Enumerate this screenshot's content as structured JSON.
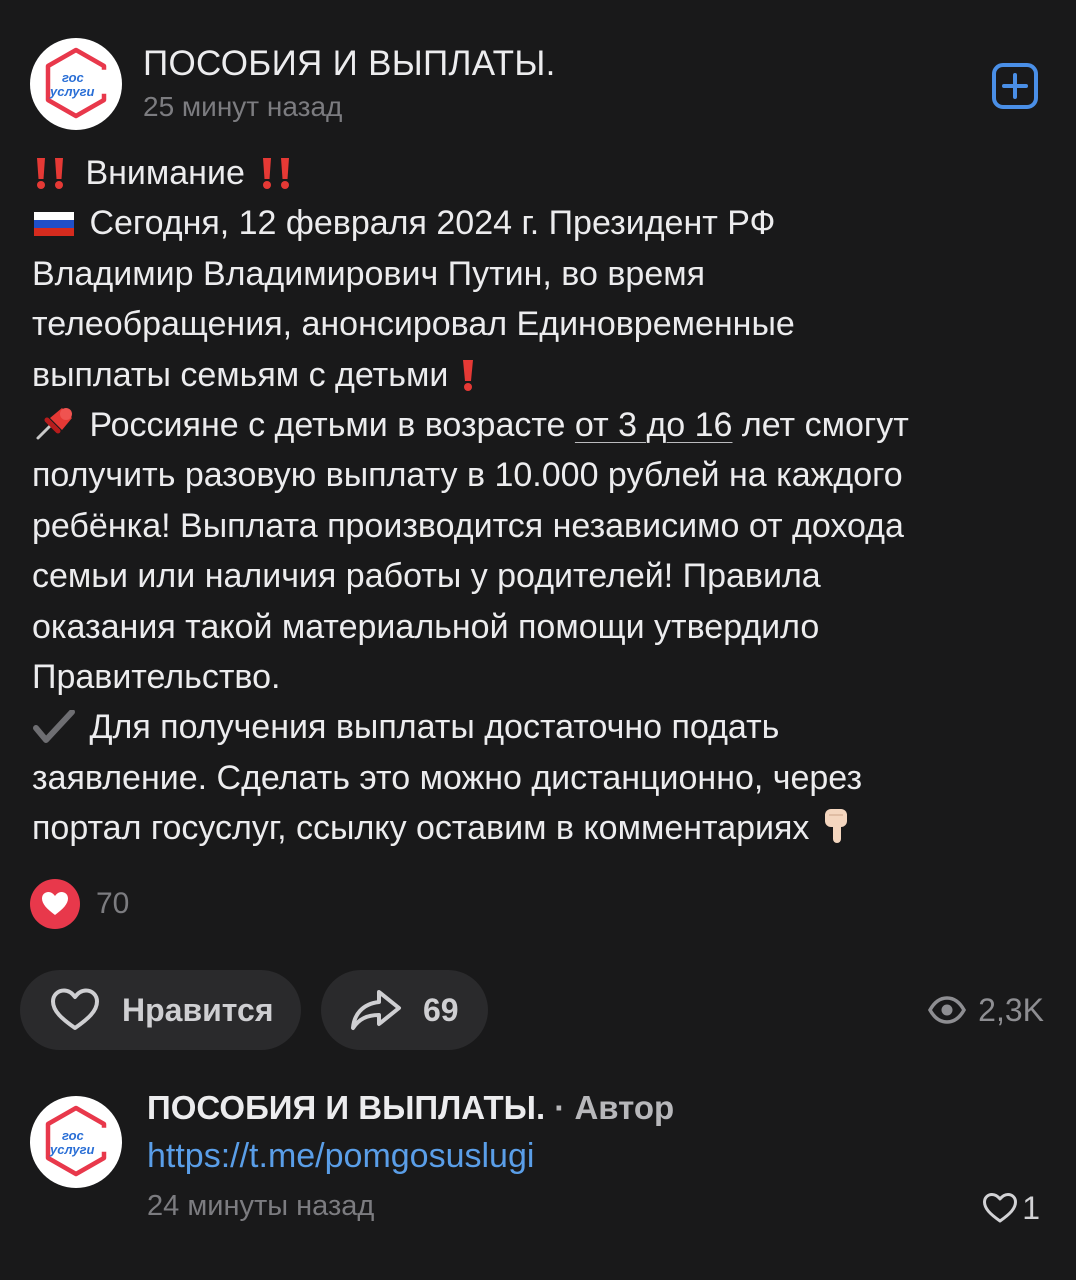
{
  "post": {
    "channel_name": "ПОСОБИЯ И ВЫПЛАТЫ.",
    "time": "25 минут назад",
    "avatar_text_top": "гос",
    "avatar_text_bottom": "услуги",
    "lines": {
      "l1_text": "Внимание",
      "l2_text": "Сегодня, 12 февраля 2024 г. Президент РФ",
      "l3_text": "Владимир Владимирович Путин, во время",
      "l4_text": "телеобращения, анонсировал Единовременные",
      "l5_text": "выплаты семьям с детьми",
      "l6_pre": "Россияне с детьми в возрасте ",
      "l6_underlined": "от 3 до 16",
      "l6_post": " лет смогут",
      "l7_text": "получить разовую выплату в 10.000 рублей на каждого",
      "l8_text": "ребёнка! Выплата производится независимо от дохода",
      "l9_text": "семьи или наличия работы у родителей! Правила",
      "l10_text": "оказания такой материальной помощи утвердило",
      "l11_text": "Правительство.",
      "l12_text": "Для получения выплаты достаточно подать",
      "l13_text": "заявление. Сделать это можно дистанционно, через",
      "l14_text": "портал госуслуг, ссылку оставим в комментариях"
    },
    "emoji": {
      "double_exclamation": "double-exclamation-icon",
      "russia_flag": "russia-flag-icon",
      "red_exclamation": "red-exclamation-icon",
      "pushpin": "pushpin-icon",
      "check_mark": "check-mark-icon",
      "point_down": "pointing-down-hand-icon"
    },
    "reaction_count": "70",
    "like_label": "Нравится",
    "share_count": "69",
    "views_count": "2,3K"
  },
  "comment": {
    "author": "ПОСОБИЯ И ВЫПЛАТЫ.",
    "separator": " · ",
    "role": "Автор",
    "link": "https://t.me/pomgosuslugi",
    "time": "24 минуты назад",
    "like_count": "1"
  },
  "colors": {
    "background": "#19191a",
    "accent_blue": "#4a8fe7",
    "link_blue": "#5a9ee8",
    "reaction_red": "#e8384b",
    "gosuslugi_blue": "#2a6fd6",
    "gosuslugi_red": "#e8384b"
  }
}
